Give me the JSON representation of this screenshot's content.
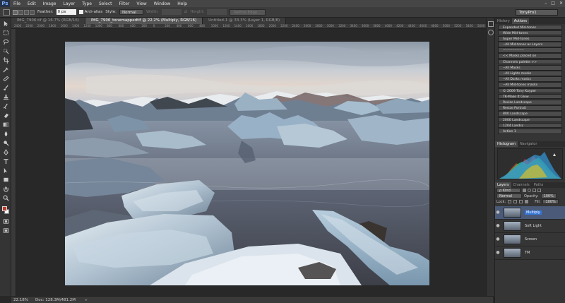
{
  "app": {
    "logo": "Ps"
  },
  "menu": [
    "File",
    "Edit",
    "Image",
    "Layer",
    "Type",
    "Select",
    "Filter",
    "View",
    "Window",
    "Help"
  ],
  "window_controls": [
    "–",
    "□",
    "✕"
  ],
  "options": {
    "feather_label": "Feather:",
    "feather_value": "0 px",
    "antialias_label": "Anti-alias",
    "style_label": "Style:",
    "style_value": "Normal",
    "width_label": "Width:",
    "height_label": "Height:",
    "refine_button": "Refine Edge...",
    "workspace": "TonyPro1"
  },
  "tabs": [
    {
      "label": "IMG_7906.tif @ 16.7% (RGB/16)",
      "active": false
    },
    {
      "label": "IMG_7906_tonemappedtif @ 22.2% (Multiply, RGB/16)",
      "active": true
    },
    {
      "label": "Untitled-1 @ 33.3% (Layer 1, RGB/8)",
      "active": false
    }
  ],
  "ruler": [
    "2400",
    "2200",
    "2000",
    "1800",
    "1600",
    "1400",
    "1200",
    "1000",
    "800",
    "600",
    "400",
    "200",
    "0",
    "200",
    "400",
    "600",
    "800",
    "1000",
    "1200",
    "1400",
    "1600",
    "1800",
    "2000",
    "2200",
    "2400",
    "2600",
    "2800",
    "3000",
    "3200",
    "3400",
    "3600",
    "3800",
    "4000",
    "4200",
    "4400",
    "4600",
    "4800",
    "5000",
    "5200",
    "5400",
    "5600"
  ],
  "status": {
    "zoom": "22.18%",
    "doc": "Doc: 128.3M/481.2M"
  },
  "history_panel": {
    "tabs": [
      "History",
      "Actions"
    ],
    "actions": [
      "Expanded Mid-tones",
      "Wide Mid-tones",
      "Super Mid-tones",
      "--All Mid-tones as Layers",
      "------------------",
      "<< Masks placed on",
      "Channels palette >>",
      "--All Masks",
      "--All Lights masks",
      "--All Darks masks",
      "--All Mid-tones masks",
      "© 2009 Tony Kuyper",
      "TK-Make It Glow",
      "Resize Landscape",
      "Resize Portrait",
      "800 Landscape",
      "2000 Landscape",
      "1204 Landsc",
      "Action 1"
    ]
  },
  "histogram_panel": {
    "tabs": [
      "Histogram",
      "Navigator"
    ]
  },
  "layers_panel": {
    "tabs": [
      "Layers",
      "Channels",
      "Paths"
    ],
    "kind": "ρ Kind",
    "blend_mode": "Normal",
    "opacity_label": "Opacity:",
    "opacity_value": "100%",
    "lock_label": "Lock:",
    "fill_label": "Fill:",
    "fill_value": "100%",
    "layers": [
      {
        "name": "Multiply",
        "selected": true
      },
      {
        "name": "Soft Light",
        "selected": false
      },
      {
        "name": "Screen",
        "selected": false
      },
      {
        "name": "TM",
        "selected": false
      }
    ]
  },
  "colors": {
    "foreground": "#c0392b",
    "background": "#ffffff",
    "selection": "#3575d6"
  }
}
